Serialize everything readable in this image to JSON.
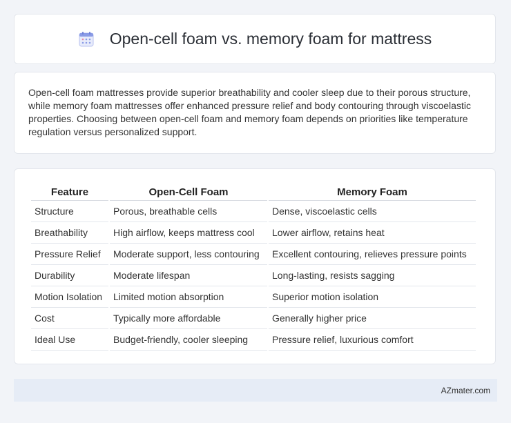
{
  "header": {
    "title": "Open-cell foam vs. memory foam for mattress",
    "icon": "calendar-icon",
    "icon_color": "#7b8fe0"
  },
  "summary": {
    "text": "Open-cell foam mattresses provide superior breathability and cooler sleep due to their porous structure, while memory foam mattresses offer enhanced pressure relief and body contouring through viscoelastic properties. Choosing between open-cell foam and memory foam depends on priorities like temperature regulation versus personalized support."
  },
  "table": {
    "headers": [
      "Feature",
      "Open-Cell Foam",
      "Memory Foam"
    ],
    "rows": [
      [
        "Structure",
        "Porous, breathable cells",
        "Dense, viscoelastic cells"
      ],
      [
        "Breathability",
        "High airflow, keeps mattress cool",
        "Lower airflow, retains heat"
      ],
      [
        "Pressure Relief",
        "Moderate support, less contouring",
        "Excellent contouring, relieves pressure points"
      ],
      [
        "Durability",
        "Moderate lifespan",
        "Long-lasting, resists sagging"
      ],
      [
        "Motion Isolation",
        "Limited motion absorption",
        "Superior motion isolation"
      ],
      [
        "Cost",
        "Typically more affordable",
        "Generally higher price"
      ],
      [
        "Ideal Use",
        "Budget-friendly, cooler sleeping",
        "Pressure relief, luxurious comfort"
      ]
    ]
  },
  "footer": {
    "brand": "AZmater.com"
  }
}
